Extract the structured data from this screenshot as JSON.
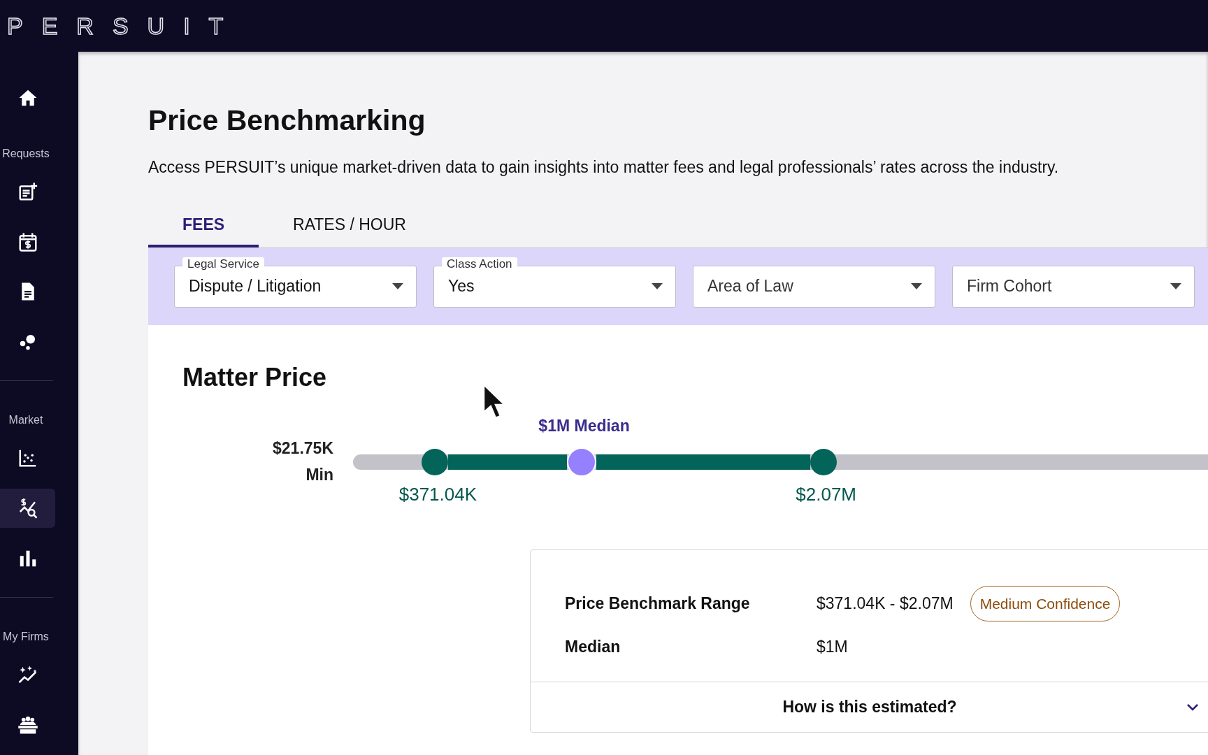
{
  "logo": "PERSUIT",
  "sidebar": {
    "sections": [
      {
        "items": [
          {
            "selected": false
          }
        ]
      },
      {
        "label": "Requests",
        "items": [
          {
            "selected": false
          },
          {
            "selected": false
          },
          {
            "selected": false
          },
          {
            "selected": false
          }
        ]
      },
      {
        "label": "Market",
        "items": [
          {
            "selected": false
          },
          {
            "selected": true
          },
          {
            "selected": false
          }
        ]
      },
      {
        "label": "My Firms",
        "items": [
          {
            "selected": false
          },
          {
            "selected": false
          }
        ]
      }
    ]
  },
  "page": {
    "title": "Price Benchmarking",
    "description": "Access PERSUIT’s unique market-driven data to gain insights into matter fees and legal professionals’ rates across the industry."
  },
  "tabs": [
    {
      "label": "FEES",
      "selected": true
    },
    {
      "label": "RATES / HOUR",
      "selected": false
    }
  ],
  "filters": [
    {
      "label": "Legal Service",
      "value": "Dispute / Litigation"
    },
    {
      "label": "Class Action",
      "value": "Yes"
    },
    {
      "placeholder": "Area of Law"
    },
    {
      "placeholder": "Firm Cohort"
    }
  ],
  "matter_price": {
    "title": "Matter Price",
    "min_value": "$21.75K",
    "min_label": "Min",
    "median_label": "$1M Median",
    "low": {
      "level": 0.096,
      "label": "$371.04K"
    },
    "median": {
      "level": 0.267
    },
    "high": {
      "level": 0.55,
      "label": "$2.07M"
    }
  },
  "summary": {
    "rows": [
      {
        "label": "Price Benchmark Range",
        "value": "$371.04K - $2.07M",
        "badge": "Medium Confidence"
      },
      {
        "label": "Median",
        "value": "$1M"
      }
    ],
    "accordion": {
      "title": "How is this estimated?",
      "expanded": false
    }
  }
}
